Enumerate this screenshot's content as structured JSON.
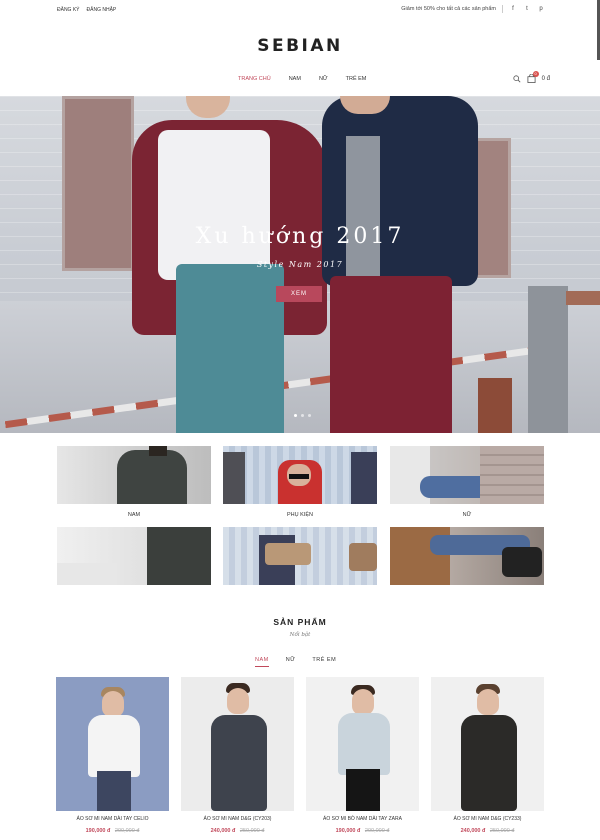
{
  "topbar": {
    "register": "ĐĂNG KÝ",
    "login": "ĐĂNG NHẬP",
    "promo": "Giảm tới 50% cho tất cả các sản phẩm",
    "social": [
      "f",
      "t",
      "p"
    ]
  },
  "brand": {
    "logo": "SEBIAN"
  },
  "nav": {
    "items": [
      "TRANG CHỦ",
      "NAM",
      "NỮ",
      "TRẺ EM"
    ],
    "active": "TRANG CHỦ"
  },
  "cart": {
    "count": "0",
    "total": "0 đ",
    "search_icon": "search-icon",
    "cart_icon": "shopping-bag-icon"
  },
  "hero": {
    "title": "Xu hướng 2017",
    "subtitle": "Style Nam 2017",
    "button": "XEM",
    "slides": 3,
    "active_slide": 1
  },
  "categories": [
    {
      "label": "NAM"
    },
    {
      "label": "PHỤ KIỆN"
    },
    {
      "label": "NỮ"
    }
  ],
  "products_section": {
    "title": "SẢN PHẨM",
    "subtitle": "Nổi bật",
    "tabs": [
      "NAM",
      "NỮ",
      "TRẺ EM"
    ],
    "active_tab": "NAM",
    "items": [
      {
        "name": "ÁO SƠ MI NAM DÀI TAY CELIO",
        "price": "190,000 đ",
        "old_price": "200,000 đ"
      },
      {
        "name": "ÁO SƠ MI NAM D&G (CY203)",
        "price": "240,000 đ",
        "old_price": "250,000 đ"
      },
      {
        "name": "ÁO SƠ MI BÒ NAM DÀI TAY ZARA",
        "price": "190,000 đ",
        "old_price": "200,000 đ"
      },
      {
        "name": "ÁO SƠ MI NAM D&G (CY233)",
        "price": "240,000 đ",
        "old_price": "250,000 đ"
      }
    ]
  },
  "colors": {
    "accent": "#c1495b",
    "text": "#333333"
  }
}
